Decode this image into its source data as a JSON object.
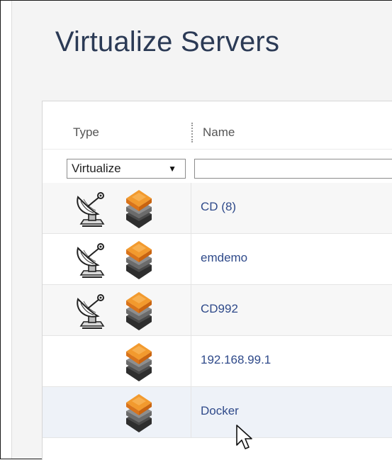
{
  "page": {
    "title": "Virtualize Servers"
  },
  "table": {
    "columns": {
      "type": "Type",
      "name": "Name"
    },
    "filters": {
      "type_selected": "Virtualize",
      "name_value": ""
    },
    "rows": [
      {
        "name": "CD (8)",
        "icons": [
          "satellite-dish-icon",
          "layered-stack-icon"
        ]
      },
      {
        "name": "emdemo",
        "icons": [
          "satellite-dish-icon",
          "layered-stack-icon"
        ]
      },
      {
        "name": "CD992",
        "icons": [
          "satellite-dish-icon",
          "layered-stack-icon"
        ]
      },
      {
        "name": "192.168.99.1",
        "icons": [
          "layered-stack-icon"
        ]
      },
      {
        "name": "Docker",
        "icons": [
          "layered-stack-icon"
        ]
      }
    ]
  },
  "colors": {
    "title": "#2b3a55",
    "link": "#2f4a8a",
    "accent_orange": "#f08c1a",
    "hover_row": "#eef2f8"
  }
}
